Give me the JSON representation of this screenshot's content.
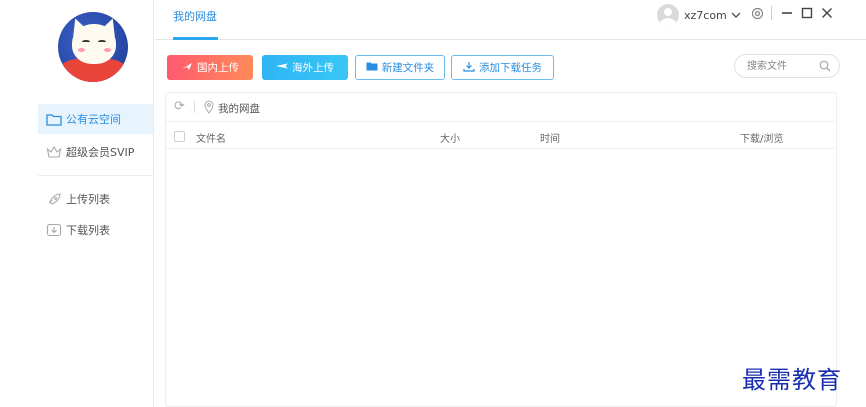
{
  "topbar": {
    "active_tab": "我的网盘",
    "username": "xz7com"
  },
  "sidebar": {
    "items": [
      {
        "label": "公有云空间",
        "icon": "folder-icon",
        "active": true
      },
      {
        "label": "超级会员SVIP",
        "icon": "crown-icon",
        "active": false
      },
      {
        "label": "上传列表",
        "icon": "rocket-icon",
        "active": false
      },
      {
        "label": "下载列表",
        "icon": "download-list-icon",
        "active": false
      }
    ]
  },
  "toolbar": {
    "domestic_upload": "国内上传",
    "overseas_upload": "海外上传",
    "new_folder": "新建文件夹",
    "add_download": "添加下载任务",
    "search_placeholder": "搜索文件"
  },
  "file_panel": {
    "breadcrumb": "我的网盘",
    "columns": [
      "文件名",
      "大小",
      "时间",
      "下载/浏览"
    ]
  },
  "watermark": "最需教育",
  "colors": {
    "accent": "#2a8ee0",
    "domestic_gradient": [
      "#ff5a6e",
      "#ff8a5a"
    ],
    "overseas_gradient": [
      "#2fb4f5",
      "#38c6f5"
    ],
    "active_nav_bg": "#e8f4fd"
  }
}
